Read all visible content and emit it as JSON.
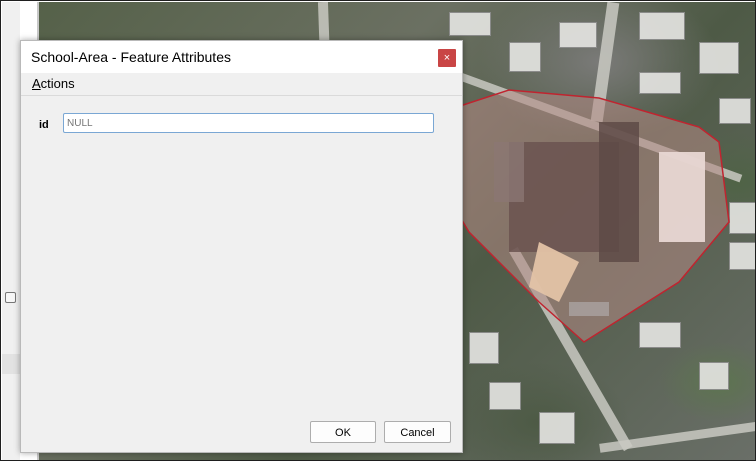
{
  "dialog": {
    "title": "School-Area - Feature Attributes",
    "close_glyph": "×",
    "menu": {
      "actions_mnemonic": "A",
      "actions_rest": "ctions"
    },
    "fields": [
      {
        "label": "id",
        "value": "",
        "placeholder": "NULL"
      }
    ],
    "buttons": {
      "ok": "OK",
      "cancel": "Cancel"
    }
  },
  "map": {
    "layer_outline_color": "#c0242f",
    "icons": [
      "checkbox-icon"
    ]
  }
}
